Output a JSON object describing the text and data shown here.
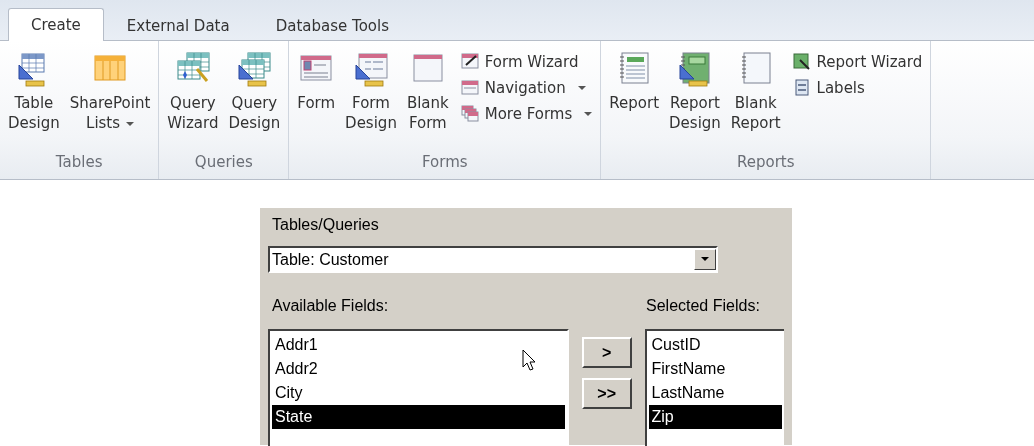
{
  "ribbon": {
    "tabs": [
      {
        "label": "Create",
        "selected": true
      },
      {
        "label": "External Data",
        "selected": false
      },
      {
        "label": "Database Tools",
        "selected": false
      }
    ],
    "groups": [
      {
        "label": "Tables",
        "large": [
          {
            "label": "Table\nDesign",
            "dropdown": false
          },
          {
            "label": "SharePoint\nLists",
            "dropdown": true
          }
        ]
      },
      {
        "label": "Queries",
        "large": [
          {
            "label": "Query\nWizard",
            "dropdown": false
          },
          {
            "label": "Query\nDesign",
            "dropdown": false
          }
        ]
      },
      {
        "label": "Forms",
        "large": [
          {
            "label": "Form",
            "dropdown": false
          },
          {
            "label": "Form\nDesign",
            "dropdown": false
          },
          {
            "label": "Blank\nForm",
            "dropdown": false
          }
        ],
        "small": [
          {
            "label": "Form Wizard",
            "dropdown": false
          },
          {
            "label": "Navigation",
            "dropdown": true
          },
          {
            "label": "More Forms",
            "dropdown": true
          }
        ]
      },
      {
        "label": "Reports",
        "large": [
          {
            "label": "Report",
            "dropdown": false
          },
          {
            "label": "Report\nDesign",
            "dropdown": false
          },
          {
            "label": "Blank\nReport",
            "dropdown": false
          }
        ],
        "small": [
          {
            "label": "Report Wizard",
            "dropdown": false
          },
          {
            "label": "Labels",
            "dropdown": false
          }
        ]
      }
    ]
  },
  "dialog": {
    "source_label": "Tables/Queries",
    "source_value": "Table: Customer",
    "available_label": "Available Fields:",
    "available": [
      {
        "label": "Addr1",
        "selected": false
      },
      {
        "label": "Addr2",
        "selected": false
      },
      {
        "label": "City",
        "selected": false
      },
      {
        "label": "State",
        "selected": true
      }
    ],
    "move_buttons": [
      ">",
      ">>"
    ],
    "selected_label": "Selected Fields:",
    "selected_fields": [
      {
        "label": "CustID",
        "selected": false
      },
      {
        "label": "FirstName",
        "selected": false
      },
      {
        "label": "LastName",
        "selected": false
      },
      {
        "label": "Zip",
        "selected": true
      }
    ]
  }
}
